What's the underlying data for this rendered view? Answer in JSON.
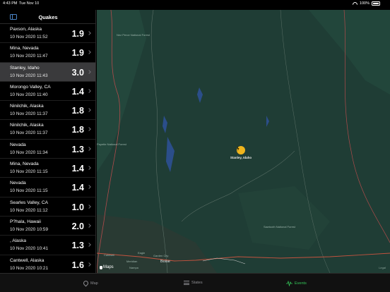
{
  "status_bar": {
    "time": "4:43 PM",
    "date": "Tue Nov 10",
    "battery": "100%"
  },
  "sidebar": {
    "title": "Quakes"
  },
  "quakes": [
    {
      "place": "Paxson, Alaska",
      "time": "10 Nov 2020 11:52",
      "magnitude": "1.9",
      "selected": false
    },
    {
      "place": "Mina, Nevada",
      "time": "10 Nov 2020 11:47",
      "magnitude": "1.9",
      "selected": false
    },
    {
      "place": "Stanley, Idaho",
      "time": "10 Nov 2020 11:43",
      "magnitude": "3.0",
      "selected": true
    },
    {
      "place": "Morongo Valley, CA",
      "time": "10 Nov 2020 11:40",
      "magnitude": "1.4",
      "selected": false
    },
    {
      "place": "Ninilchik, Alaska",
      "time": "10 Nov 2020 11:37",
      "magnitude": "1.8",
      "selected": false
    },
    {
      "place": "Ninilchik, Alaska",
      "time": "10 Nov 2020 11:37",
      "magnitude": "1.8",
      "selected": false
    },
    {
      "place": "Nevada",
      "time": "10 Nov 2020 11:34",
      "magnitude": "1.3",
      "selected": false
    },
    {
      "place": "Mina, Nevada",
      "time": "10 Nov 2020 11:15",
      "magnitude": "1.4",
      "selected": false
    },
    {
      "place": "Nevada",
      "time": "10 Nov 2020 11:15",
      "magnitude": "1.4",
      "selected": false
    },
    {
      "place": "Searles Valley, CA",
      "time": "10 Nov 2020 11:12",
      "magnitude": "1.0",
      "selected": false
    },
    {
      "place": "P?hala, Hawaii",
      "time": "10 Nov 2020 10:59",
      "magnitude": "2.0",
      "selected": false
    },
    {
      "place": ", Alaska",
      "time": "10 Nov 2020 10:41",
      "magnitude": "1.3",
      "selected": false
    },
    {
      "place": "Cantwell, Alaska",
      "time": "10 Nov 2020 10:21",
      "magnitude": "1.6",
      "selected": false
    }
  ],
  "map": {
    "pin_label": "Stanley, Idaho",
    "labels": {
      "caldwell": "Caldwell",
      "nampa": "Nampa",
      "meridian": "Meridian",
      "boise": "Boise",
      "garden_city": "Garden City",
      "eagle": "Eagle",
      "forest_north": "Nez Perce National Forest",
      "forest_south": "Sawtooth National Forest",
      "forest_west": "Payette National Forest"
    },
    "logo": "Maps",
    "legal": "Legal"
  },
  "colors": {
    "accent": "#34c759",
    "pin": "#f0b51d",
    "selected_row": "#3a3a3c",
    "map_terrain": "#1f3d35"
  },
  "tabs": [
    {
      "label": "Map",
      "icon": "map-icon",
      "active": false
    },
    {
      "label": "States",
      "icon": "list-icon",
      "active": false
    },
    {
      "label": "Events",
      "icon": "waveform-icon",
      "active": true
    }
  ]
}
